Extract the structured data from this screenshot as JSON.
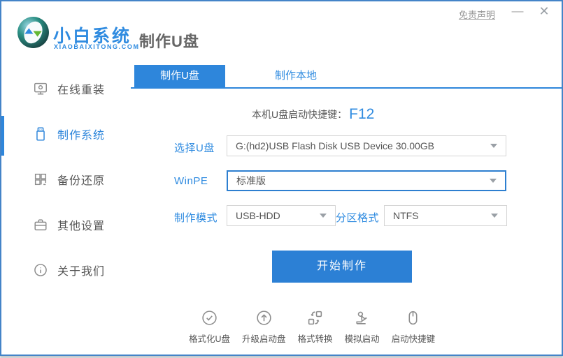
{
  "titlebar": {
    "disclaimer": "免责声明",
    "minimize_label": "—",
    "close_label": "✕"
  },
  "header": {
    "brand_name": "小白系统",
    "brand_domain": "XIAOBAIXITONG.COM",
    "page_title": "制作U盘"
  },
  "sidebar": {
    "items": [
      {
        "label": "在线重装",
        "icon": "monitor-icon",
        "active": false
      },
      {
        "label": "制作系统",
        "icon": "usb-drive-icon",
        "active": true
      },
      {
        "label": "备份还原",
        "icon": "backup-grid-icon",
        "active": false
      },
      {
        "label": "其他设置",
        "icon": "toolbox-icon",
        "active": false
      },
      {
        "label": "关于我们",
        "icon": "info-icon",
        "active": false
      }
    ]
  },
  "tabs": [
    {
      "label": "制作U盘",
      "active": true
    },
    {
      "label": "制作本地",
      "active": false
    }
  ],
  "hotkey": {
    "label": "本机U盘启动快捷键：",
    "value": "F12"
  },
  "form": {
    "usb": {
      "label": "选择U盘",
      "value": "G:(hd2)USB Flash Disk USB Device 30.00GB"
    },
    "winpe": {
      "label": "WinPE",
      "value": "标准版"
    },
    "mode": {
      "label": "制作模式",
      "value": "USB-HDD"
    },
    "partition": {
      "label": "分区格式",
      "value": "NTFS"
    },
    "start_button": "开始制作"
  },
  "footer_tools": [
    {
      "label": "格式化U盘",
      "icon": "check-circle-icon"
    },
    {
      "label": "升级启动盘",
      "icon": "arrow-up-circle-icon"
    },
    {
      "label": "格式转换",
      "icon": "convert-icon"
    },
    {
      "label": "模拟启动",
      "icon": "stamp-icon"
    },
    {
      "label": "启动快捷键",
      "icon": "mouse-icon"
    }
  ],
  "colors": {
    "primary_blue": "#2E86DB",
    "text_blue": "#2F8BE0",
    "window_border": "#4484C8"
  }
}
